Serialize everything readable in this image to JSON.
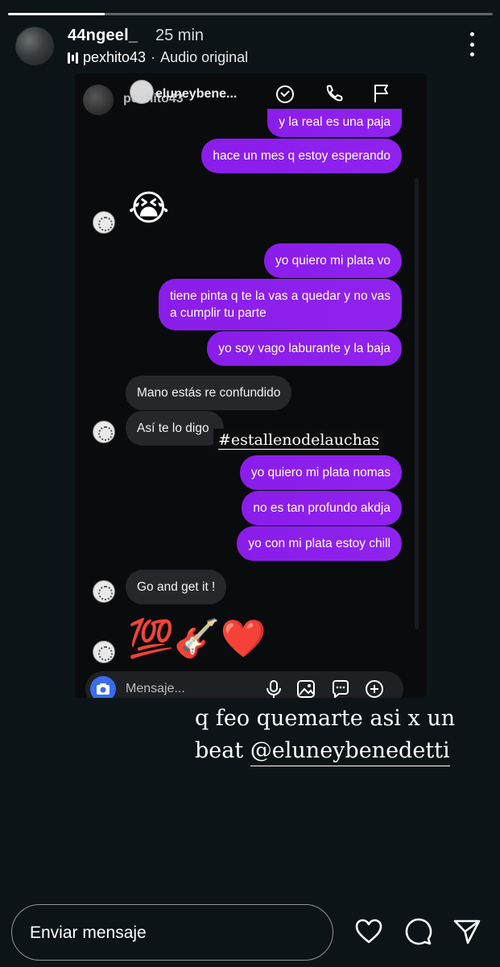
{
  "story": {
    "progress": 0.2,
    "username": "44ngeel_",
    "time": "25 min",
    "audio_user": "pexhito43",
    "separator": "·",
    "audio_label": "Audio original"
  },
  "embedded_chat": {
    "header_name_front": "eluneybene...",
    "header_name_back": "pexhito43",
    "messages": [
      {
        "side": "me",
        "text": "y la real es una paja"
      },
      {
        "side": "me",
        "text": "hace un mes q estoy esperando"
      },
      {
        "side": "them",
        "text": "😭"
      },
      {
        "side": "me",
        "text": "yo quiero mi plata vo"
      },
      {
        "side": "me",
        "text": "tiene pinta q te la vas a quedar y no vas a cumplir tu parte"
      },
      {
        "side": "me",
        "text": "yo soy vago laburante y la baja"
      },
      {
        "side": "them",
        "text": "Mano estás re confundido"
      },
      {
        "side": "them",
        "text": "Así te lo digo"
      },
      {
        "side": "me",
        "text": "yo quiero mi plata nomas"
      },
      {
        "side": "me",
        "text": "no es tan profundo akdja"
      },
      {
        "side": "me",
        "text": "yo con mi plata estoy chill"
      },
      {
        "side": "them",
        "text": "Go and get it !"
      },
      {
        "side": "them",
        "text": "💯🎸❤️"
      }
    ],
    "hashtag": "#estallenodelauchas",
    "composer_placeholder": "Mensaje..."
  },
  "caption": {
    "line1": "q feo quemarte asi x un",
    "line2_prefix": "beat ",
    "mention": "@eluneybenedetti"
  },
  "reply_bar": {
    "placeholder": "Enviar mensaje"
  },
  "colors": {
    "background": "#0c1417",
    "my_bubble": "#8a1ee6",
    "their_bubble": "#26272b",
    "camera_button": "#3a6cf0"
  }
}
